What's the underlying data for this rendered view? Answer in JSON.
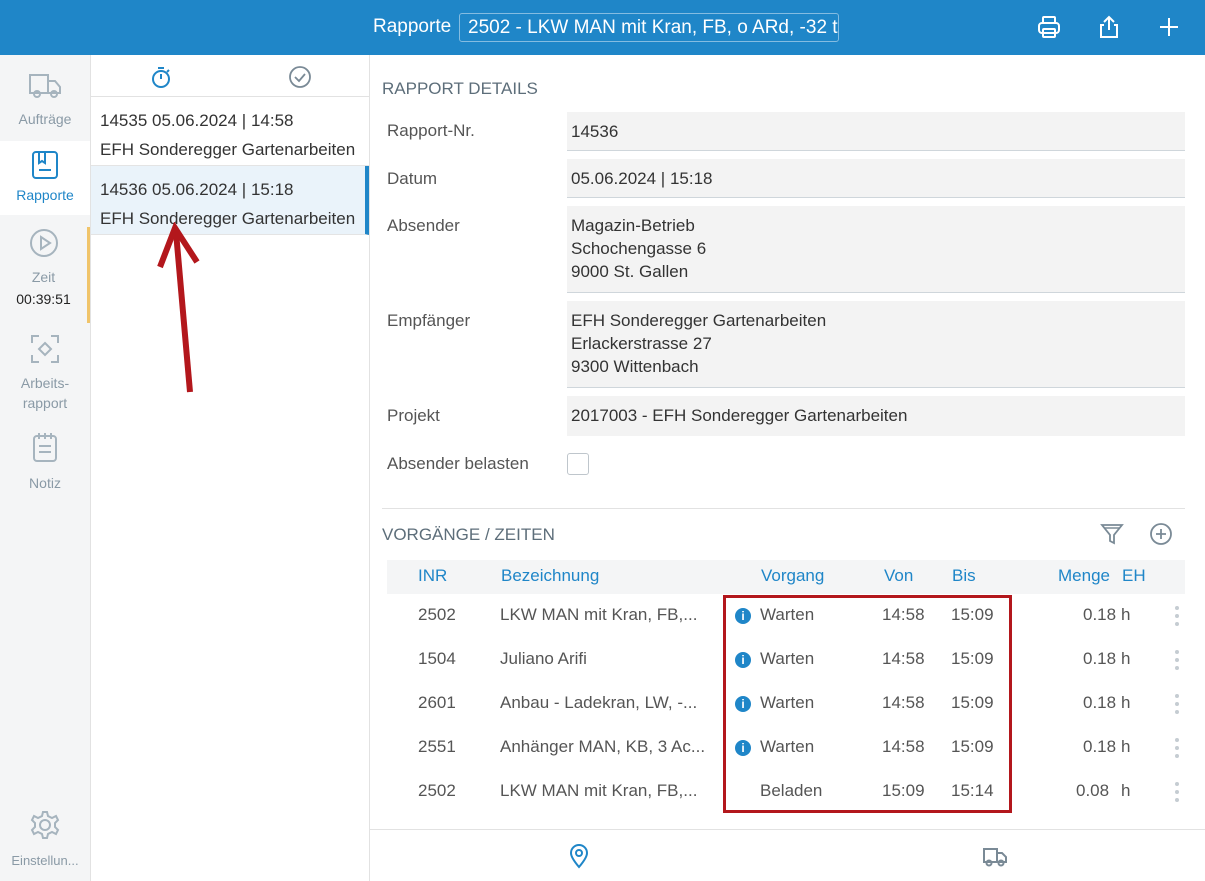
{
  "header": {
    "title": "Rapporte",
    "selected_vehicle": "2502 - LKW MAN mit Kran, FB, o ARd, -32 t"
  },
  "nav": {
    "items": [
      {
        "label": "Aufträge",
        "icon": "truck-icon"
      },
      {
        "label": "Rapporte",
        "icon": "report-icon"
      },
      {
        "label": "Zeit",
        "icon": "play-icon",
        "time": "00:39:51"
      },
      {
        "label": "Arbeits-\nrapport",
        "icon": "scan-target-icon"
      },
      {
        "label": "Notiz",
        "icon": "notepad-icon"
      }
    ],
    "settings_label": "Einstellun..."
  },
  "list": {
    "rows": [
      {
        "line1": "14535  05.06.2024 | 14:58",
        "line2": "EFH Sonderegger Gartenarbeiten"
      },
      {
        "line1": "14536  05.06.2024 | 15:18",
        "line2": "EFH Sonderegger Gartenarbeiten"
      }
    ]
  },
  "details": {
    "section_title": "RAPPORT DETAILS",
    "rapport_nr_label": "Rapport-Nr.",
    "rapport_nr": "14536",
    "datum_label": "Datum",
    "datum": "05.06.2024 | 15:18",
    "absender_label": "Absender",
    "absender": [
      "Magazin-Betrieb",
      "Schochengasse 6",
      "9000 St. Gallen"
    ],
    "empfaenger_label": "Empfänger",
    "empfaenger": [
      "EFH Sonderegger Gartenarbeiten",
      "Erlackerstrasse 27",
      "9300 Wittenbach"
    ],
    "projekt_label": "Projekt",
    "projekt": "2017003 - EFH Sonderegger Gartenarbeiten",
    "absender_belasten_label": "Absender belasten",
    "absender_belasten": false
  },
  "vorgaenge": {
    "section_title": "VORGÄNGE / ZEITEN",
    "columns": {
      "inr": "INR",
      "bezeichnung": "Bezeichnung",
      "vorgang": "Vorgang",
      "von": "Von",
      "bis": "Bis",
      "menge": "Menge",
      "eh": "EH"
    },
    "rows": [
      {
        "inr": "2502",
        "bezeichnung": "LKW MAN mit Kran, FB,...",
        "info": true,
        "vorgang": "Warten",
        "von": "14:58",
        "bis": "15:09",
        "menge": "0.18",
        "eh": "h"
      },
      {
        "inr": "1504",
        "bezeichnung": "Juliano Arifi",
        "info": true,
        "vorgang": "Warten",
        "von": "14:58",
        "bis": "15:09",
        "menge": "0.18",
        "eh": "h"
      },
      {
        "inr": "2601",
        "bezeichnung": "Anbau - Ladekran, LW, -...",
        "info": true,
        "vorgang": "Warten",
        "von": "14:58",
        "bis": "15:09",
        "menge": "0.18",
        "eh": "h"
      },
      {
        "inr": "2551",
        "bezeichnung": "Anhänger MAN, KB, 3 Ac...",
        "info": true,
        "vorgang": "Warten",
        "von": "14:58",
        "bis": "15:09",
        "menge": "0.18",
        "eh": "h"
      },
      {
        "inr": "2502",
        "bezeichnung": "LKW MAN mit Kran, FB,...",
        "info": false,
        "vorgang": "Beladen",
        "von": "15:09",
        "bis": "15:14",
        "menge": "0.08",
        "eh": "h"
      }
    ]
  },
  "colors": {
    "accent": "#1f86c8",
    "highlight": "#b3171c"
  }
}
